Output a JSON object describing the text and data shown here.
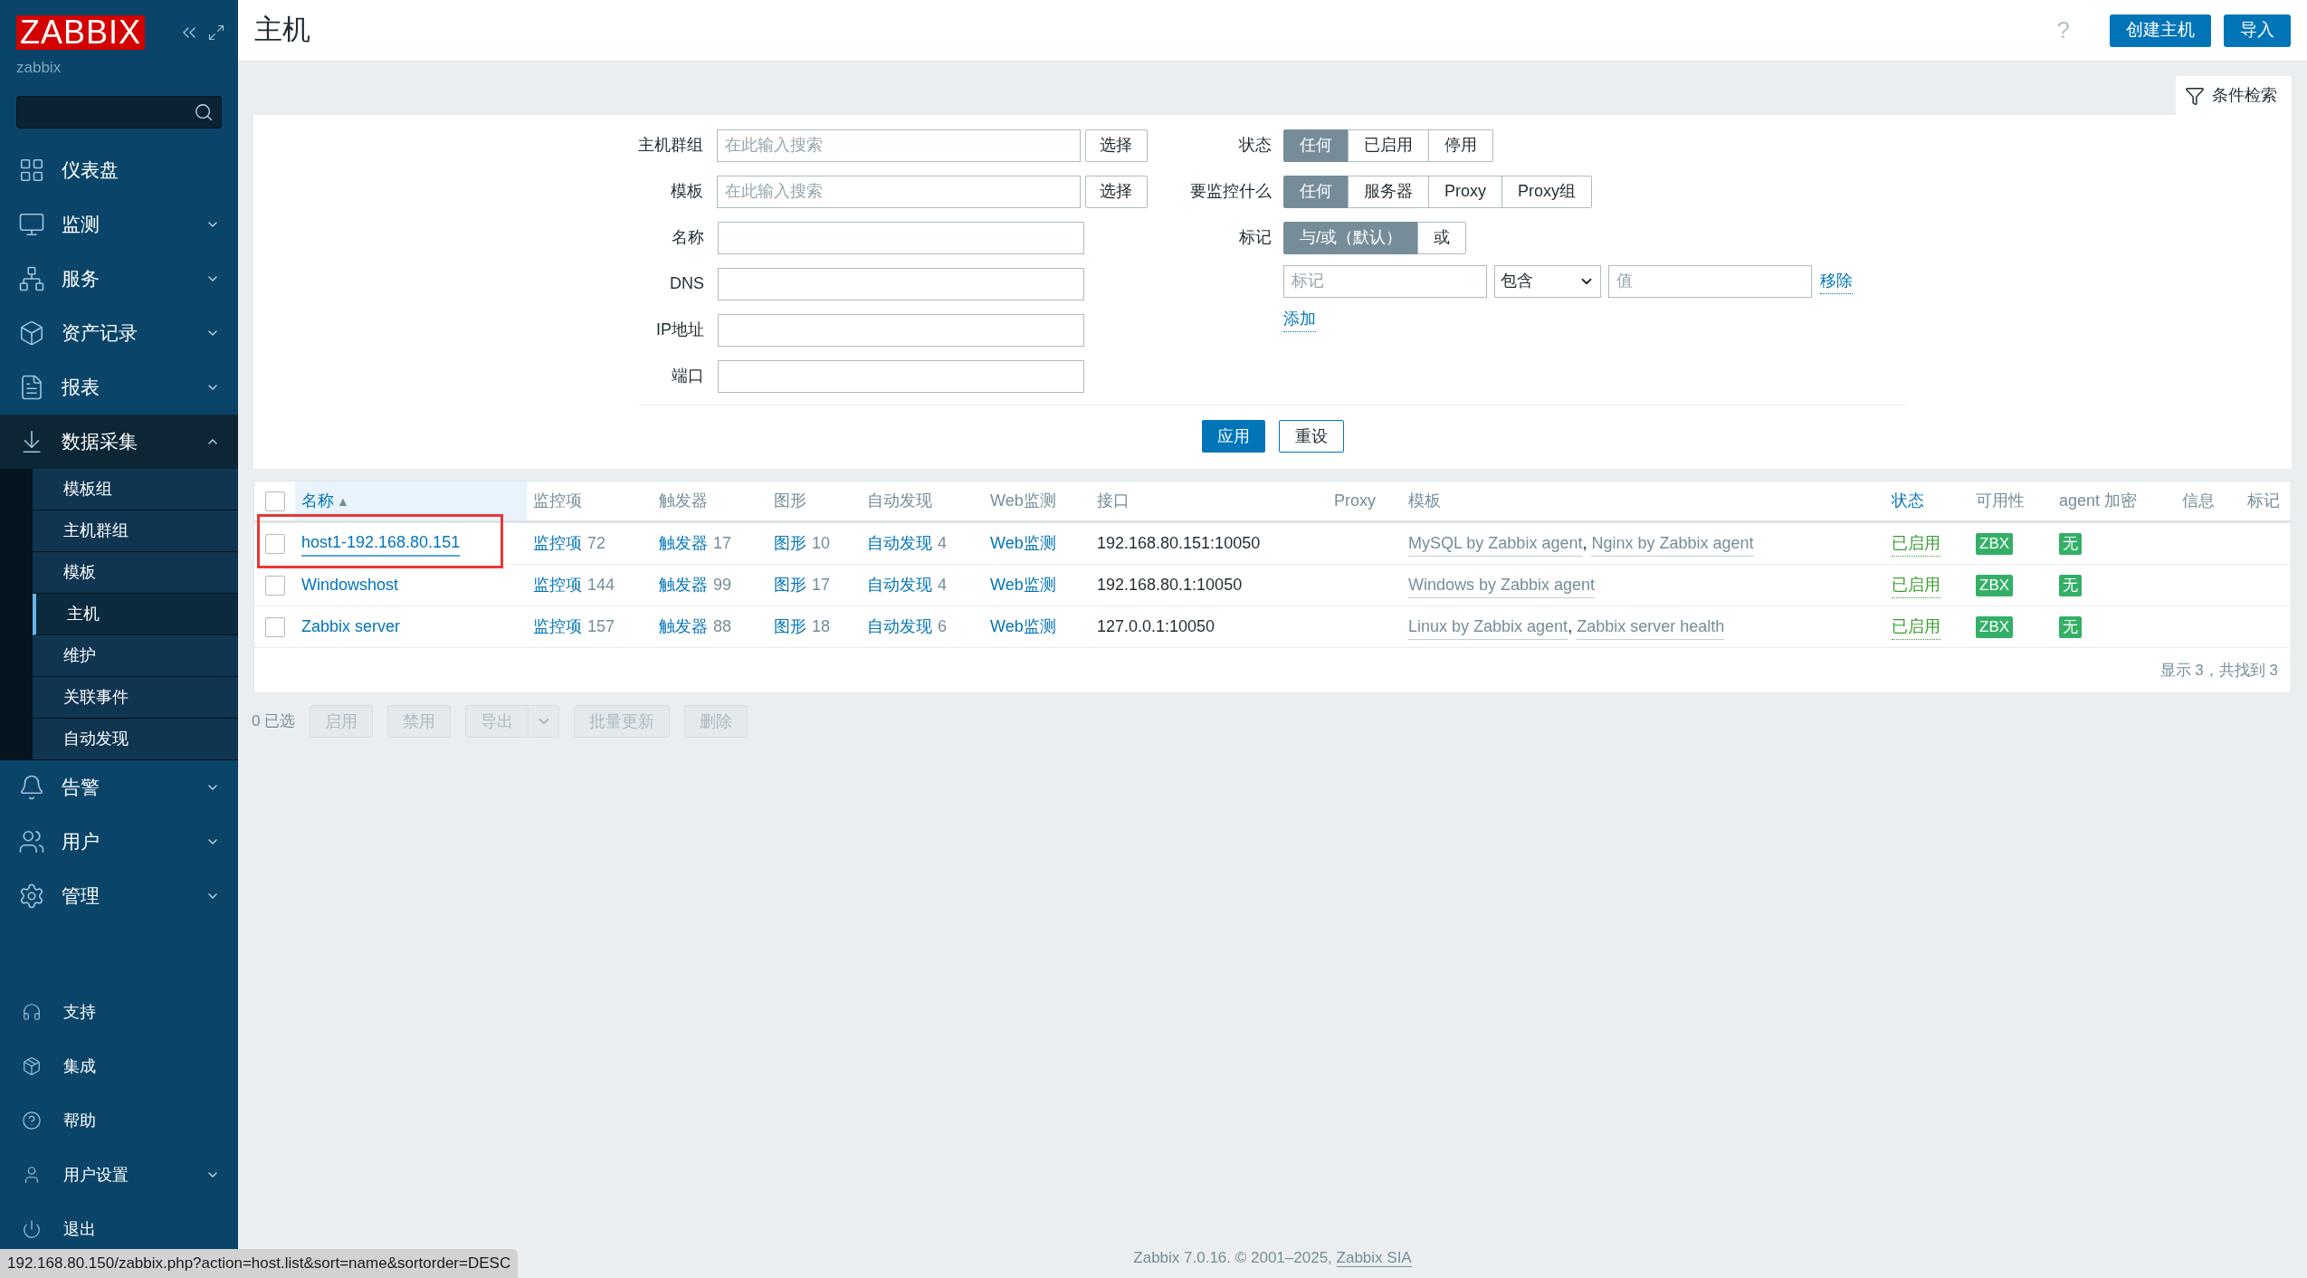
{
  "sidebar": {
    "logo": "ZABBIX",
    "server_name": "zabbix",
    "menu": [
      {
        "label": "仪表盘",
        "expandable": false,
        "expanded": false
      },
      {
        "label": "监测",
        "expandable": true,
        "expanded": false
      },
      {
        "label": "服务",
        "expandable": true,
        "expanded": false
      },
      {
        "label": "资产记录",
        "expandable": true,
        "expanded": false
      },
      {
        "label": "报表",
        "expandable": true,
        "expanded": false
      },
      {
        "label": "数据采集",
        "expandable": true,
        "expanded": true,
        "children": [
          {
            "label": "模板组",
            "selected": false
          },
          {
            "label": "主机群组",
            "selected": false
          },
          {
            "label": "模板",
            "selected": false
          },
          {
            "label": "主机",
            "selected": true
          },
          {
            "label": "维护",
            "selected": false
          },
          {
            "label": "关联事件",
            "selected": false
          },
          {
            "label": "自动发现",
            "selected": false
          }
        ]
      },
      {
        "label": "告警",
        "expandable": true,
        "expanded": false
      },
      {
        "label": "用户",
        "expandable": true,
        "expanded": false
      },
      {
        "label": "管理",
        "expandable": true,
        "expanded": false
      }
    ],
    "bottom_menu": [
      {
        "label": "支持",
        "expandable": false
      },
      {
        "label": "集成",
        "expandable": false
      },
      {
        "label": "帮助",
        "expandable": false
      },
      {
        "label": "用户设置",
        "expandable": true
      },
      {
        "label": "退出",
        "expandable": false
      }
    ]
  },
  "header": {
    "title": "主机",
    "help": "?",
    "buttons": [
      "创建主机",
      "导入"
    ]
  },
  "filter": {
    "tab_label": "条件检索",
    "fields": [
      {
        "label": "主机群组",
        "kind": "multiselect",
        "placeholder": "在此输入搜索",
        "button": "选择"
      },
      {
        "label": "模板",
        "kind": "multiselect",
        "placeholder": "在此输入搜索",
        "button": "选择"
      },
      {
        "label": "名称",
        "kind": "text"
      },
      {
        "label": "DNS",
        "kind": "text"
      },
      {
        "label": "IP地址",
        "kind": "text"
      },
      {
        "label": "端口",
        "kind": "text"
      }
    ],
    "segments": [
      {
        "label": "状态",
        "options": [
          {
            "label": "任何",
            "selected": true
          },
          {
            "label": "已启用",
            "selected": false
          },
          {
            "label": "停用",
            "selected": false
          }
        ]
      },
      {
        "label": "要监控什么",
        "options": [
          {
            "label": "任何",
            "selected": true
          },
          {
            "label": "服务器",
            "selected": false
          },
          {
            "label": "Proxy",
            "selected": false
          },
          {
            "label": "Proxy组",
            "selected": false
          }
        ]
      },
      {
        "label": "标记",
        "options": [
          {
            "label": "与/或（默认）",
            "selected": true
          },
          {
            "label": "或",
            "selected": false
          }
        ]
      }
    ],
    "tag_rows": [
      {
        "tag_placeholder": "标记",
        "operator": "包含",
        "value_placeholder": "值",
        "remove": "移除"
      }
    ],
    "add": "添加",
    "apply": "应用",
    "reset": "重设"
  },
  "table": {
    "select_all_checked": false,
    "columns": [
      {
        "label": "名称",
        "link": true,
        "sort_mark": "▲"
      },
      {
        "label": "监控项",
        "link": false
      },
      {
        "label": "触发器",
        "link": false
      },
      {
        "label": "图形",
        "link": false
      },
      {
        "label": "自动发现",
        "link": false
      },
      {
        "label": "Web监测",
        "link": false
      },
      {
        "label": "接口",
        "link": false
      },
      {
        "label": "Proxy",
        "link": false
      },
      {
        "label": "模板",
        "link": false
      },
      {
        "label": "状态",
        "link": true
      },
      {
        "label": "可用性",
        "link": false
      },
      {
        "label": "agent 加密",
        "link": false
      },
      {
        "label": "信息",
        "link": false
      },
      {
        "label": "标记",
        "link": false
      }
    ],
    "template_separator": ", ",
    "rows": [
      {
        "name": "host1-192.168.80.151",
        "highlighted": true,
        "checked": false,
        "items": {
          "label": "监控项",
          "count": "72"
        },
        "triggers": {
          "label": "触发器",
          "count": "17"
        },
        "graphs": {
          "label": "图形",
          "count": "10"
        },
        "discovery": {
          "label": "自动发现",
          "count": "4"
        },
        "web": "Web监测",
        "interface": "192.168.80.151:10050",
        "templates": [
          "MySQL by Zabbix agent",
          "Nginx by Zabbix agent"
        ],
        "status": "已启用",
        "availability": "ZBX",
        "encryption": "无"
      },
      {
        "name": "Windowshost",
        "highlighted": false,
        "checked": false,
        "items": {
          "label": "监控项",
          "count": "144"
        },
        "triggers": {
          "label": "触发器",
          "count": "99"
        },
        "graphs": {
          "label": "图形",
          "count": "17"
        },
        "discovery": {
          "label": "自动发现",
          "count": "4"
        },
        "web": "Web监测",
        "interface": "192.168.80.1:10050",
        "templates": [
          "Windows by Zabbix agent"
        ],
        "status": "已启用",
        "availability": "ZBX",
        "encryption": "无"
      },
      {
        "name": "Zabbix server",
        "highlighted": false,
        "checked": false,
        "items": {
          "label": "监控项",
          "count": "157"
        },
        "triggers": {
          "label": "触发器",
          "count": "88"
        },
        "graphs": {
          "label": "图形",
          "count": "18"
        },
        "discovery": {
          "label": "自动发现",
          "count": "6"
        },
        "web": "Web监测",
        "interface": "127.0.0.1:10050",
        "templates": [
          "Linux by Zabbix agent",
          "Zabbix server health"
        ],
        "status": "已启用",
        "availability": "ZBX",
        "encryption": "无"
      }
    ],
    "summary": "显示 3，共找到 3"
  },
  "actions": {
    "selected_count": "0 已选",
    "buttons": [
      {
        "label": "启用",
        "kind": "plain",
        "disabled": true
      },
      {
        "label": "禁用",
        "kind": "plain",
        "disabled": true
      },
      {
        "label": "导出",
        "kind": "split",
        "disabled": true
      },
      {
        "label": "批量更新",
        "kind": "plain",
        "disabled": true
      },
      {
        "label": "删除",
        "kind": "plain",
        "disabled": true
      }
    ]
  },
  "footer": {
    "text": "Zabbix 7.0.16. © 2001–2025, ",
    "link": "Zabbix SIA"
  },
  "status_bar": "192.168.80.150/zabbix.php?action=host.list&sort=name&sortorder=DESC"
}
